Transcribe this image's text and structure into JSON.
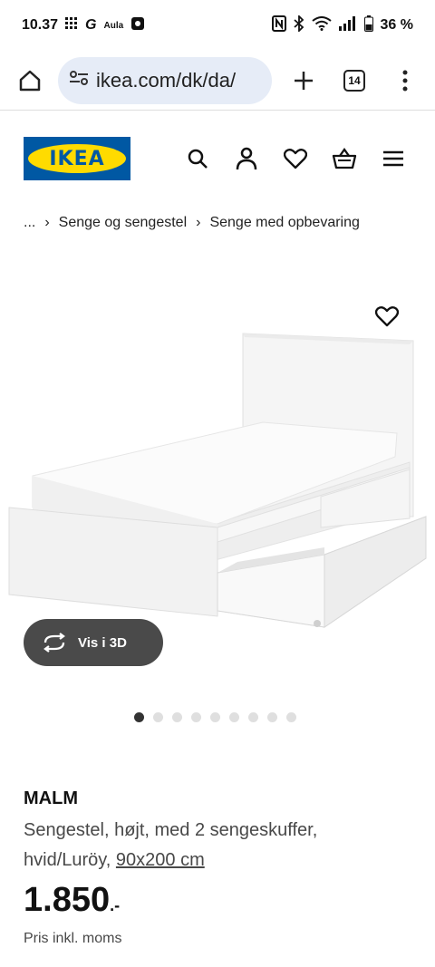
{
  "status_bar": {
    "time": "10.37",
    "app_icon_label": "Aula",
    "battery": "36 %"
  },
  "browser": {
    "url": "ikea.com/dk/da/",
    "tab_count": "14"
  },
  "site": {
    "logo_text": "IKEA",
    "brand_blue": "#0058a3",
    "brand_yellow": "#ffdb00"
  },
  "breadcrumb": {
    "ellipsis": "...",
    "items": [
      "Senge og sengestel",
      "Senge med opbevaring"
    ]
  },
  "gallery": {
    "view_3d_label": "Vis i 3D",
    "dot_count": 9,
    "active_index": 0
  },
  "product": {
    "name": "MALM",
    "description": "Sengestel, højt, med 2 sengeskuffer, hvid/Luröy, ",
    "size": "90x200 cm",
    "price": "1.850",
    "price_suffix": ".-",
    "price_note": "Pris inkl. moms"
  }
}
